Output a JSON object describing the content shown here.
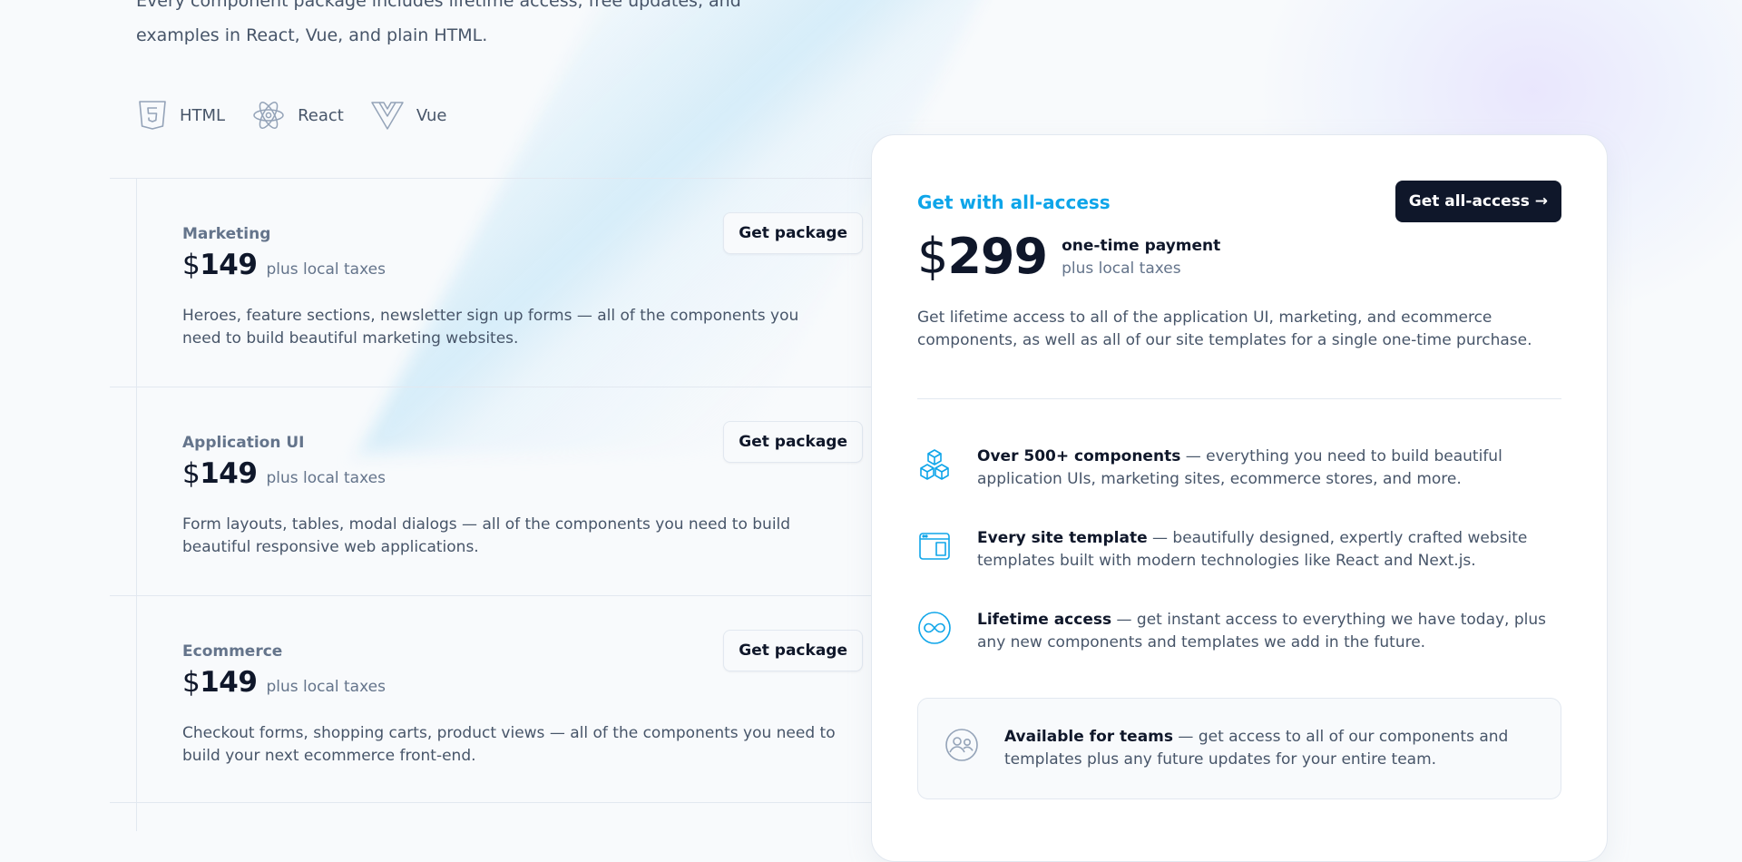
{
  "intro": {
    "line1": "Every component package includes lifetime access, free updates, and",
    "line2": "examples in React, Vue, and plain HTML."
  },
  "frameworks": [
    {
      "label": "HTML",
      "icon": "html5-icon"
    },
    {
      "label": "React",
      "icon": "react-icon"
    },
    {
      "label": "Vue",
      "icon": "vue-icon"
    }
  ],
  "packages": [
    {
      "title": "Marketing",
      "currency": "$",
      "price": "149",
      "tax": "plus local taxes",
      "description": "Heroes, feature sections, newsletter sign up forms — all of the components you need to build beautiful marketing websites.",
      "button": "Get package"
    },
    {
      "title": "Application UI",
      "currency": "$",
      "price": "149",
      "tax": "plus local taxes",
      "description": "Form layouts, tables, modal dialogs — all of the components you need to build beautiful responsive web applications.",
      "button": "Get package"
    },
    {
      "title": "Ecommerce",
      "currency": "$",
      "price": "149",
      "tax": "plus local taxes",
      "description": "Checkout forms, shopping carts, product views — all of the components you need to build your next ecommerce front-end.",
      "button": "Get package"
    }
  ],
  "allaccess": {
    "eyebrow": "Get with all-access",
    "cta": "Get all-access →",
    "currency": "$",
    "price": "299",
    "payment_note": "one-time payment",
    "tax": "plus local taxes",
    "description": "Get lifetime access to all of the application UI, marketing, and ecommerce components, as well as all of our site templates for a single one-time purchase.",
    "features": [
      {
        "title": "Over 500+ components",
        "text": " — everything you need to build beautiful application UIs, marketing sites, ecommerce stores, and more.",
        "icon": "cubes-icon"
      },
      {
        "title": "Every site template",
        "text": " — beautifully designed, expertly crafted website templates built with modern technologies like React and Next.js.",
        "icon": "browser-window-icon"
      },
      {
        "title": "Lifetime access",
        "text": " — get instant access to everything we have today, plus any new components and templates we add in the future.",
        "icon": "infinity-icon"
      }
    ],
    "teams": {
      "title": "Available for teams",
      "text": " — get access to all of our components and templates plus any future updates for your entire team.",
      "icon": "team-icon"
    }
  },
  "colors": {
    "accent": "#0ea5e9",
    "dark": "#0f172a",
    "muted": "#64748b",
    "border": "#e2e8f0"
  }
}
